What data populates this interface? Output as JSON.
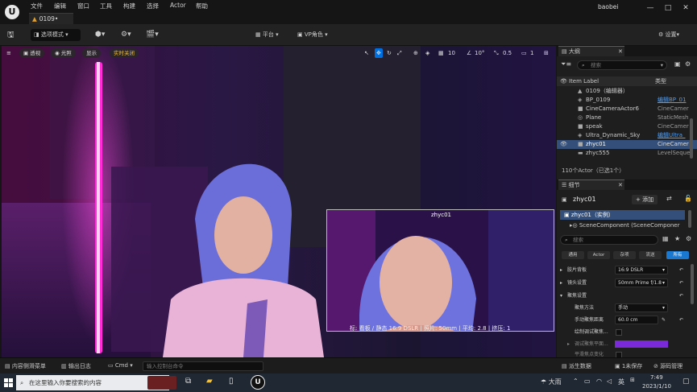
{
  "app": {
    "logo": "U",
    "menus": [
      "文件",
      "编辑",
      "窗口",
      "工具",
      "构建",
      "选择",
      "Actor",
      "帮助"
    ],
    "project_tab": "0109•",
    "user": "baobei",
    "window_buttons": {
      "minimize": "—",
      "maximize": "□",
      "close": "✕"
    }
  },
  "toolbar": {
    "save_icon": "save-icon",
    "mode_label": "选项模式",
    "platform_label": "平台",
    "vp_role_label": "VP角色",
    "settings_label": "设置"
  },
  "viewport": {
    "menu_icon": "≡",
    "perspective": "透视",
    "lighting": "光照",
    "show": "显示",
    "material_badge": "实时关闭",
    "grid_value": "10",
    "angle_value": "10°",
    "scale_value": "0.5",
    "camera_count": "1",
    "pip": {
      "name": "zhyc01",
      "info": "标: 看板 / 静态 16:9 DSLR | 照片: 50mm | 平均: 2.8 | 挤压: 1"
    }
  },
  "outliner": {
    "tab": "大纲",
    "search_placeholder": "搜索",
    "col_label": "Item Label",
    "col_type": "类型",
    "rows": [
      {
        "label": "0109（编辑器）",
        "type": "",
        "selected": false,
        "type_link": false
      },
      {
        "label": "BP_0109",
        "type": "编辑BP_01",
        "selected": false,
        "type_link": true
      },
      {
        "label": "CineCameraActor6",
        "type": "CineCamer",
        "selected": false,
        "type_link": false
      },
      {
        "label": "Plane",
        "type": "StaticMesh",
        "selected": false,
        "type_link": false
      },
      {
        "label": "speak",
        "type": "CineCamer",
        "selected": false,
        "type_link": false
      },
      {
        "label": "Ultra_Dynamic_Sky",
        "type": "编辑Ultra_",
        "selected": false,
        "type_link": true
      },
      {
        "label": "zhyc01",
        "type": "CineCamer",
        "selected": true,
        "type_link": false
      },
      {
        "label": "zhyc555",
        "type": "LevelSeque",
        "selected": false,
        "type_link": false
      }
    ],
    "footer": "110个Actor（已选1个）"
  },
  "details": {
    "tab": "细节",
    "actor_name": "zhyc01",
    "add_label": "+ 添加",
    "instance_label": "zhyc01（实例）",
    "component_label": "SceneComponent (SceneComponer",
    "search_placeholder": "搜索",
    "filters": [
      "通用",
      "Actor",
      "杂项",
      "流送",
      "所有"
    ],
    "properties": [
      {
        "label": "胶片背板",
        "value": "16:9 DSLR"
      },
      {
        "label": "镜头设置",
        "value": "50mm Prime f/1.8"
      },
      {
        "label": "聚焦设置",
        "value": ""
      },
      {
        "label": "聚焦方法",
        "value": "手动"
      },
      {
        "label": "手动聚焦距离",
        "value": "60.0 cm"
      },
      {
        "label": "绘制调试聚焦...",
        "value": ""
      },
      {
        "label": "调试聚焦平面...",
        "value": ""
      },
      {
        "label": "平滑焦点变化",
        "value": ""
      }
    ]
  },
  "statusbar": {
    "content_drawer": "内容侧滑菜单",
    "output_log": "输出日志",
    "cmd": "Cmd",
    "cmd_placeholder": "输入控制台命令",
    "derived_data": "派生数据",
    "unsaved": "1未保存",
    "source_control": "源码管理"
  },
  "taskbar": {
    "search_placeholder": "在这里输入你要搜索的内容",
    "weather": "大雨",
    "ime": "英",
    "time": "7:49",
    "date": "2023/1/10"
  },
  "colors": {
    "accent": "#0070e0",
    "selection": "#34507a",
    "play_green": "#3bb043",
    "filter_active": "#1a78d0",
    "neon_pink": "#ff2cd8"
  }
}
